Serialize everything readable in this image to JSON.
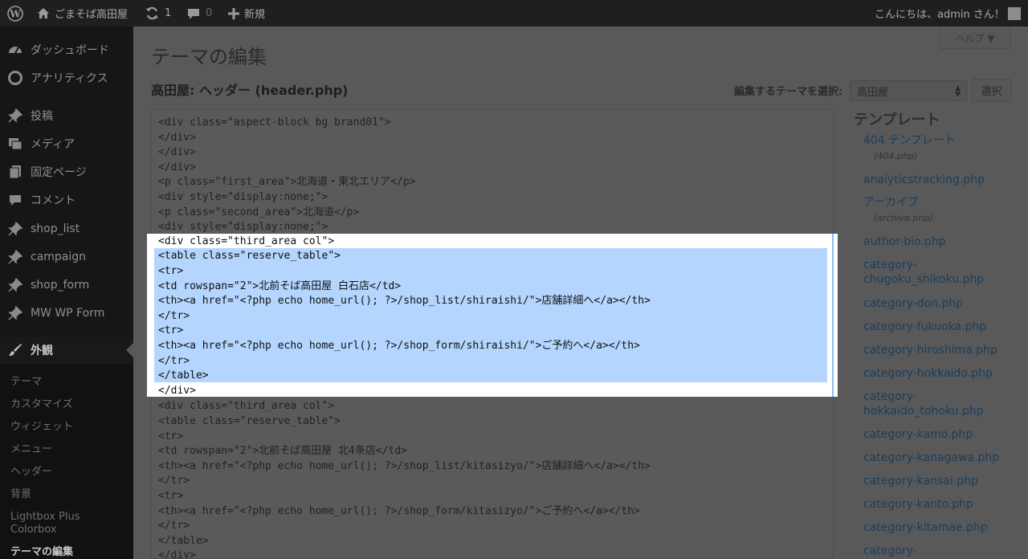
{
  "admin_bar": {
    "site_name": "ごまそば高田屋",
    "updates_count": "1",
    "comments_count": "0",
    "new_label": "新規",
    "greeting": "こんにちは、admin さん！"
  },
  "sidebar": {
    "items": [
      {
        "label": "ダッシュボード",
        "icon": "dashboard-icon"
      },
      {
        "label": "アナリティクス",
        "icon": "analytics-icon"
      },
      {
        "label": "投稿",
        "icon": "pin-icon"
      },
      {
        "label": "メディア",
        "icon": "media-icon"
      },
      {
        "label": "固定ページ",
        "icon": "pages-icon"
      },
      {
        "label": "コメント",
        "icon": "comment-icon"
      },
      {
        "label": "shop_list",
        "icon": "pin-icon"
      },
      {
        "label": "campaign",
        "icon": "pin-icon"
      },
      {
        "label": "shop_form",
        "icon": "pin-icon"
      },
      {
        "label": "MW WP Form",
        "icon": "pin-icon"
      },
      {
        "label": "外観",
        "icon": "appearance-icon"
      }
    ],
    "submenu": [
      "テーマ",
      "カスタマイズ",
      "ウィジェット",
      "メニュー",
      "ヘッダー",
      "背景",
      "Lightbox Plus Colorbox",
      "テーマの編集"
    ]
  },
  "page": {
    "title": "テーマの編集",
    "help_label": "ヘルプ ▼",
    "file_title": "高田屋: ヘッダー (header.php)",
    "select_label": "編集するテーマを選択:",
    "select_value": "高田屋",
    "select_button": "選択"
  },
  "editor": {
    "lines": [
      "<div class=\"aspect-block bg brand01\">",
      "</div>",
      "</div>",
      "</div>",
      "<p class=\"first_area\">北海道・東北エリア</p>",
      "<div style=\"display:none;\">",
      "<p class=\"second_area\">北海道</p>",
      "<div style=\"display:none;\">",
      "<div class=\"third_area col\">",
      "<table class=\"reserve_table\">",
      "<tr>",
      "<td rowspan=\"2\">北前そば高田屋 白石店</td>",
      "<th><a href=\"<?php echo home_url(); ?>/shop_list/shiraishi/\">店舗詳細へ</a></th>",
      "</tr>",
      "<tr>",
      "<th><a href=\"<?php echo home_url(); ?>/shop_form/shiraishi/\">ご予約へ</a></th>",
      "</tr>",
      "</table>",
      "</div>",
      "<div class=\"third_area col\">",
      "<table class=\"reserve_table\">",
      "<tr>",
      "<td rowspan=\"2\">北前そば高田屋 北4条店</td>",
      "<th><a href=\"<?php echo home_url(); ?>/shop_list/kitasizyo/\">店舗詳細へ</a></th>",
      "</tr>",
      "<tr>",
      "<th><a href=\"<?php echo home_url(); ?>/shop_form/kitasizyo/\">ご予約へ</a></th>",
      "</tr>",
      "</table>",
      "</div>"
    ]
  },
  "templates": {
    "heading": "テンプレート",
    "items": [
      {
        "label": "404 テンプレート",
        "file": "(404.php)"
      },
      {
        "label": "analyticstracking.php"
      },
      {
        "label": "アーカイブ",
        "file": "(archive.php)"
      },
      {
        "label": "author-bio.php"
      },
      {
        "label": "category-chugoku_shikoku.php"
      },
      {
        "label": "category-don.php"
      },
      {
        "label": "category-fukuoka.php"
      },
      {
        "label": "category-hiroshima.php"
      },
      {
        "label": "category-hokkaido.php"
      },
      {
        "label": "category-hokkaido_tohoku.php"
      },
      {
        "label": "category-kamo.php"
      },
      {
        "label": "category-kanagawa.php"
      },
      {
        "label": "category-kansai.php"
      },
      {
        "label": "category-kanto.php"
      },
      {
        "label": "category-kitamae.php"
      },
      {
        "label": "category-"
      }
    ]
  }
}
